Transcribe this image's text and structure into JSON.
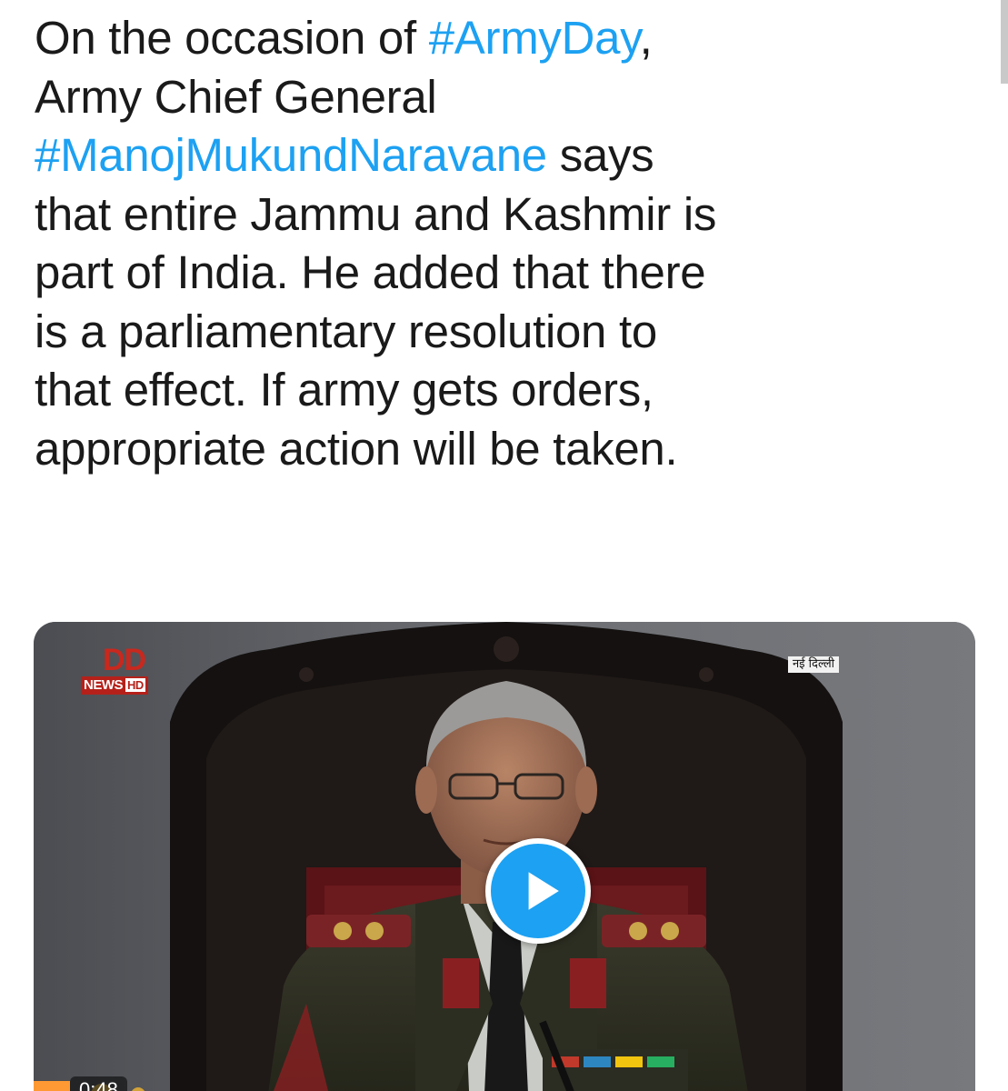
{
  "tweet": {
    "segments": [
      {
        "text": "On the occasion of ",
        "type": "text"
      },
      {
        "text": "#ArmyDay",
        "type": "hashtag"
      },
      {
        "text": ",\nArmy Chief General\n",
        "type": "text"
      },
      {
        "text": "#ManojMukundNaravane",
        "type": "hashtag"
      },
      {
        "text": " says\nthat entire Jammu and Kashmir is\npart of India. He added that there\nis a parliamentary resolution to\nthat effect. If army gets orders,\nappropriate action will be taken.",
        "type": "text"
      }
    ]
  },
  "media": {
    "type": "video",
    "channel_logo_text": "DD",
    "channel_news_text": "NEWS",
    "channel_hd_text": "HD",
    "location_tag": "नई दिल्ली",
    "play_icon": "play-icon",
    "duration": "0:48"
  },
  "colors": {
    "hashtag": "#1da1f2",
    "text": "#1a1a1a",
    "play_button": "#1da1f2",
    "channel_red": "#c8281e"
  }
}
